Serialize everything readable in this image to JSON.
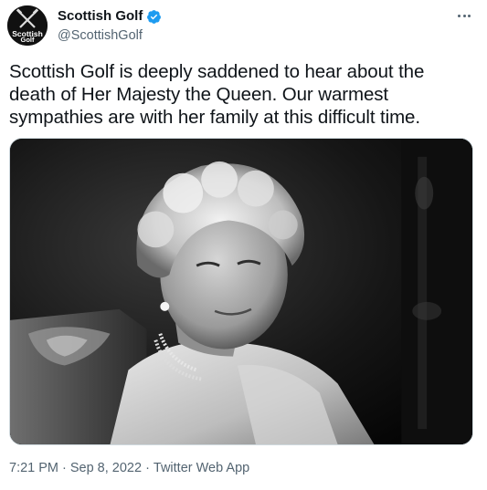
{
  "account": {
    "display_name": "Scottish Golf",
    "handle": "@ScottishGolf",
    "verified": true,
    "avatar_logo": "Scottish Golf",
    "avatar_icon": "crossed-golf-clubs-icon"
  },
  "tweet": {
    "text": "Scottish Golf is deeply saddened to hear about the death of Her Majesty the Queen. Our warmest sympathies are with her family at this difficult time."
  },
  "media": {
    "type": "photo",
    "style": "black-and-white"
  },
  "meta": {
    "time": "7:21 PM",
    "separator": "·",
    "date": "Sep 8, 2022",
    "source": "Twitter Web App"
  },
  "colors": {
    "text_primary": "#0f1419",
    "text_secondary": "#536471",
    "verified_badge": "#1d9bf0",
    "border": "#cfd9de"
  },
  "icons": {
    "more": "more-horizontal-icon",
    "verified": "verified-badge-icon"
  }
}
